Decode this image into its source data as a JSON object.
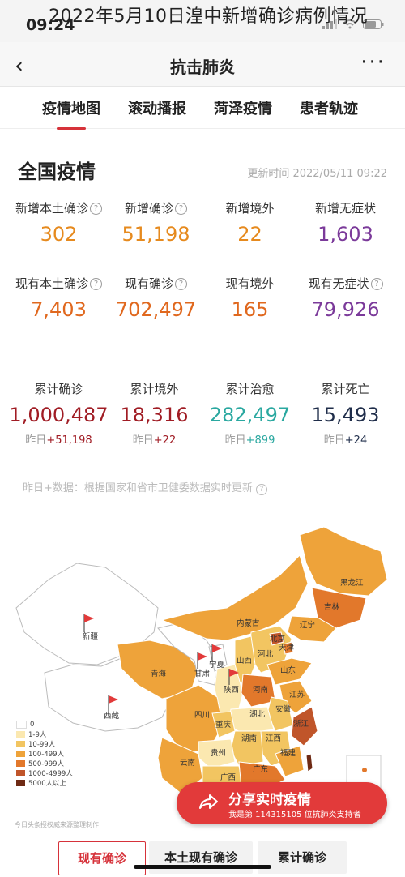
{
  "overlay_title": "2022年5月10日湟中新增确诊病例情况",
  "status": {
    "time": "09:24"
  },
  "nav": {
    "title": "抗击肺炎",
    "back": "‹",
    "more": "···"
  },
  "tabs": [
    "疫情地图",
    "滚动播报",
    "菏泽疫情",
    "患者轨迹"
  ],
  "section": {
    "title": "全国疫情",
    "updated": "更新时间 2022/05/11 09:22"
  },
  "row1": [
    {
      "label": "新增本土确诊",
      "value": "302",
      "help": true
    },
    {
      "label": "新增确诊",
      "value": "51,198",
      "help": true
    },
    {
      "label": "新增境外",
      "value": "22",
      "help": false
    },
    {
      "label": "新增无症状",
      "value": "1,603",
      "help": false
    }
  ],
  "row2": [
    {
      "label": "现有本土确诊",
      "value": "7,403",
      "help": true
    },
    {
      "label": "现有确诊",
      "value": "702,497",
      "help": true
    },
    {
      "label": "现有境外",
      "value": "165",
      "help": false
    },
    {
      "label": "现有无症状",
      "value": "79,926",
      "help": true
    }
  ],
  "row3": [
    {
      "label": "累计确诊",
      "value": "1,000,487",
      "delta_prefix": "昨日",
      "delta": "+51,198"
    },
    {
      "label": "累计境外",
      "value": "18,316",
      "delta_prefix": "昨日",
      "delta": "+22"
    },
    {
      "label": "累计治愈",
      "value": "282,497",
      "delta_prefix": "昨日",
      "delta": "+899"
    },
    {
      "label": "累计死亡",
      "value": "15,493",
      "delta_prefix": "昨日",
      "delta": "+24"
    }
  ],
  "colors": {
    "orange": "#e68a1e",
    "red": "#c0392b",
    "purple": "#7b3a9a",
    "darkred": "#a01c24",
    "teal": "#2aa8a0",
    "navy": "#1f2d4a",
    "accent": "#d6323a"
  },
  "note": "昨日+数据：根据国家和省市卫健委数据实时更新",
  "legend": [
    "0",
    "1-9人",
    "10-99人",
    "100-499人",
    "500-999人",
    "1000-4999人",
    "5000人以上"
  ],
  "legend_colors": [
    "#ffffff",
    "#fbe8b0",
    "#f2c561",
    "#eea33a",
    "#e2782b",
    "#c0552a",
    "#6e2a14"
  ],
  "provinces": [
    "新疆",
    "西藏",
    "青海",
    "甘肃",
    "宁夏",
    "内蒙古",
    "黑龙江",
    "吉林",
    "辽宁",
    "北京",
    "天津",
    "河北",
    "山西",
    "陕西",
    "河南",
    "山东",
    "江苏",
    "安徽",
    "湖北",
    "四川",
    "重庆",
    "贵州",
    "云南",
    "广西",
    "湖南",
    "江西",
    "浙江",
    "福建",
    "广东"
  ],
  "source": "今日头条授权威来源整理制作",
  "share": {
    "title": "分享实时疫情",
    "subtitle": "我是第 114315105 位抗肺炎支持者"
  },
  "bottom_tabs": [
    "现有确诊",
    "本土现有确诊",
    "累计确诊"
  ]
}
